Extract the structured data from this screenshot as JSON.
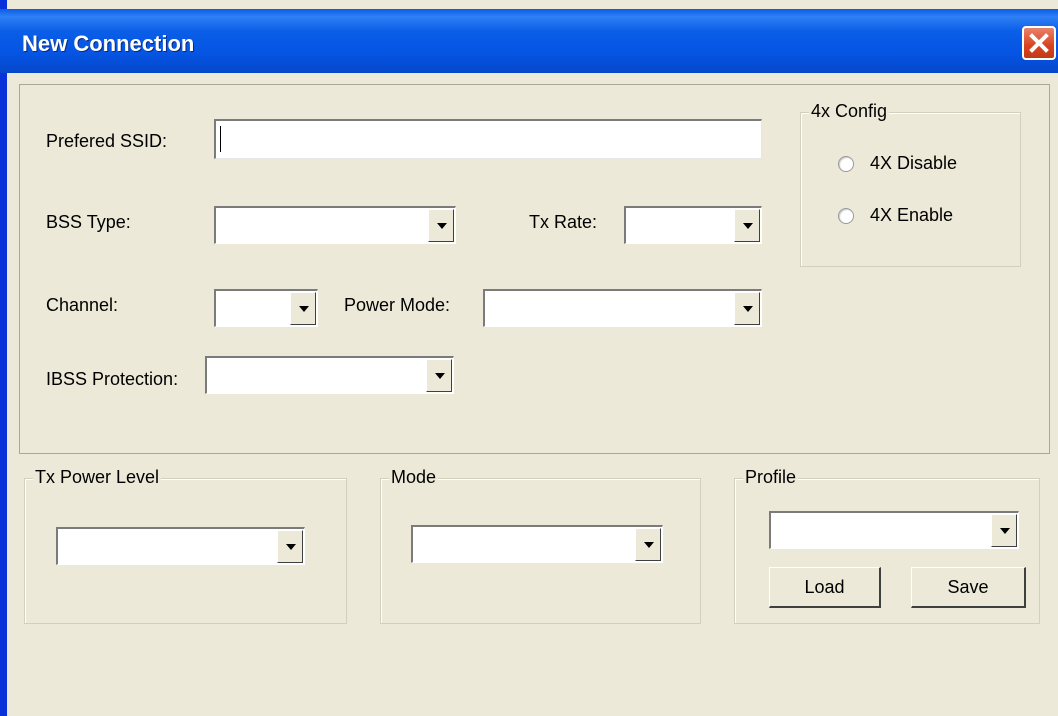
{
  "window": {
    "title": "New Connection",
    "close_icon": "close-icon"
  },
  "form": {
    "ssid": {
      "label": "Prefered SSID:",
      "value": ""
    },
    "bss_type": {
      "label": "BSS Type:",
      "value": ""
    },
    "tx_rate": {
      "label": "Tx Rate:",
      "value": ""
    },
    "channel": {
      "label": "Channel:",
      "value": ""
    },
    "power_mode": {
      "label": "Power Mode:",
      "value": ""
    },
    "ibss_protection": {
      "label": "IBSS Protection:",
      "value": ""
    }
  },
  "config_4x": {
    "title": "4x Config",
    "options": [
      {
        "label": "4X Disable",
        "selected": false
      },
      {
        "label": "4X Enable",
        "selected": false
      }
    ]
  },
  "tx_power": {
    "title": "Tx Power Level",
    "value": ""
  },
  "mode": {
    "title": "Mode",
    "value": ""
  },
  "profile": {
    "title": "Profile",
    "value": "",
    "load_label": "Load",
    "save_label": "Save"
  },
  "colors": {
    "title_bar": "#0a5ee7",
    "face": "#ece9d8",
    "close_button": "#d8431f"
  }
}
